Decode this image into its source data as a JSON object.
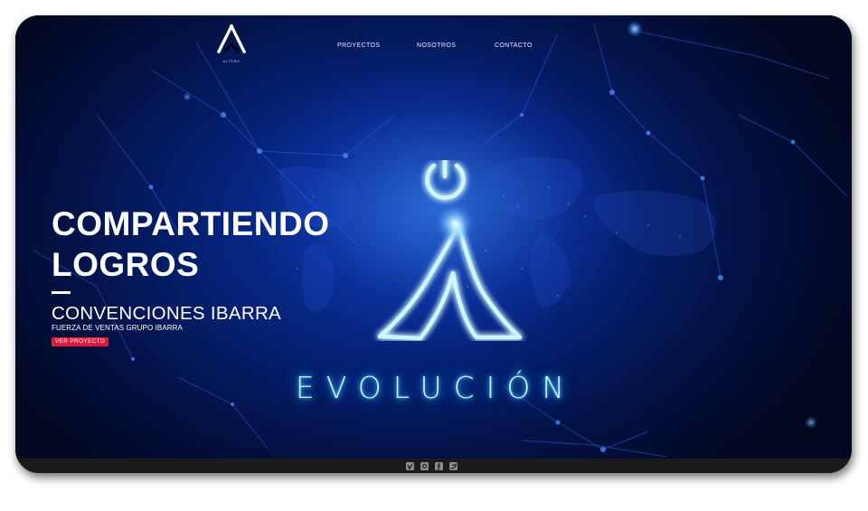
{
  "nav": {
    "logo_text": "ALTERA",
    "items": [
      {
        "label": "PROYECTOS"
      },
      {
        "label": "NOSOTROS"
      },
      {
        "label": "CONTACTO"
      }
    ]
  },
  "hero": {
    "headline_line1": "COMPARTIENDO",
    "headline_line2": "LOGROS",
    "project_title": "CONVENCIONES IBARRA",
    "project_subtitle": "FUERZA DE VENTAS GRUPO IBARRA",
    "cta_label": "VER PROYECTO",
    "slogan": "EVOLUCIÓN"
  },
  "footer": {
    "social_icons": [
      "vimeo-icon",
      "instagram-icon",
      "facebook-icon",
      "twitter-icon"
    ]
  },
  "colors": {
    "background": "#031246",
    "accent": "#e3173c",
    "glow": "#55d8ff",
    "footer": "#1b1b1d"
  }
}
